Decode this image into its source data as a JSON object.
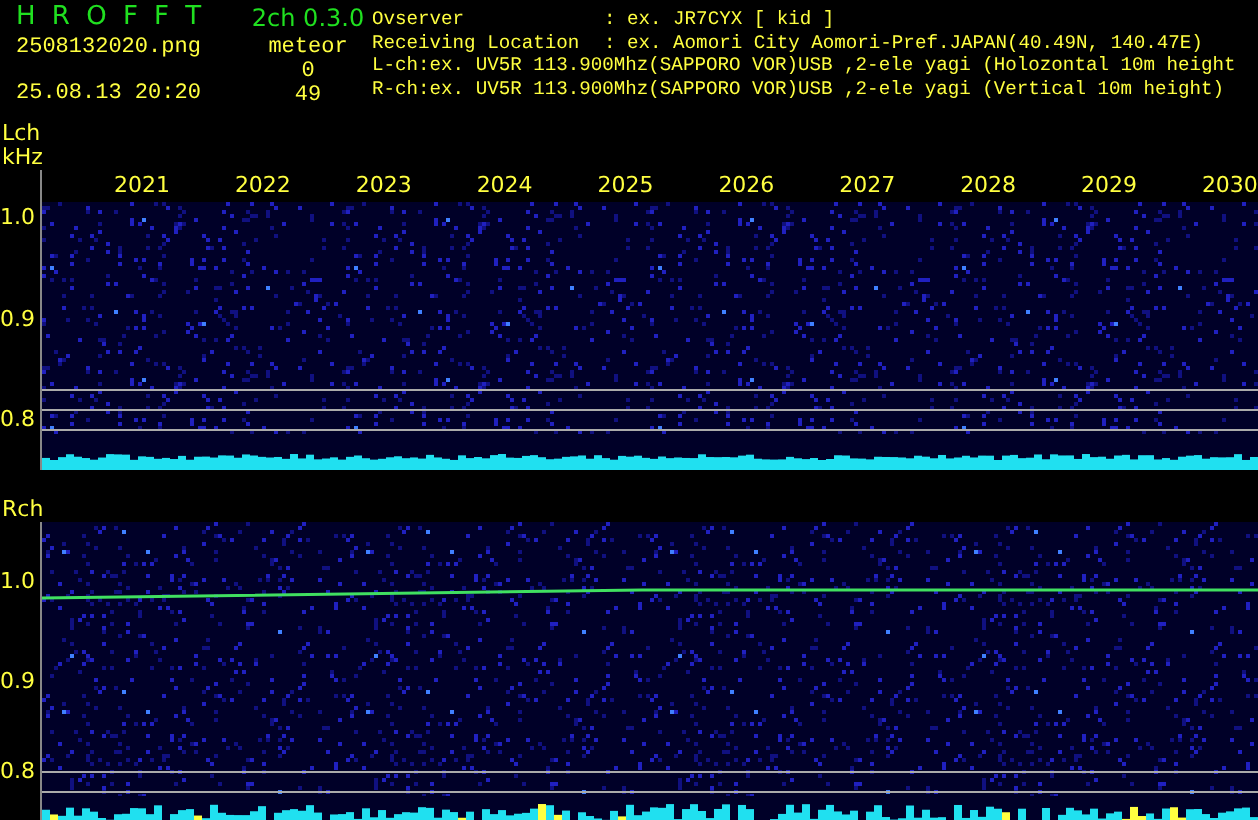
{
  "app": {
    "title": "H R O F F T",
    "version": "2ch 0.3.0",
    "filename": "2508132020.png",
    "datetime": "25.08.13 20:20",
    "meteor_label": "meteor",
    "counts": [
      "0",
      "49"
    ]
  },
  "info": [
    {
      "label": "Ovserver",
      "value": ": ex. JR7CYX [ kid ]"
    },
    {
      "label": "Receiving Location",
      "value": ": ex. Aomori City Aomori-Pref.JAPAN(40.49N, 140.47E)"
    },
    {
      "text": "L-ch:ex. UV5R 113.900Mhz(SAPPORO VOR)USB ,2-ele yagi (Holozontal 10m height"
    },
    {
      "text": "R-ch:ex. UV5R 113.900Mhz(SAPPORO VOR)USB ,2-ele yagi (Vertical 10m height)"
    }
  ],
  "panels": [
    {
      "name": "Lch",
      "unit": "kHz",
      "years": [
        "2021",
        "2022",
        "2023",
        "2024",
        "2025",
        "2026",
        "2027",
        "2028",
        "2029",
        "2030"
      ],
      "yticks": [
        "1.0",
        "0.9",
        "0.8"
      ]
    },
    {
      "name": "Rch",
      "yticks": [
        "1.0",
        "0.9",
        "0.8"
      ]
    }
  ]
}
